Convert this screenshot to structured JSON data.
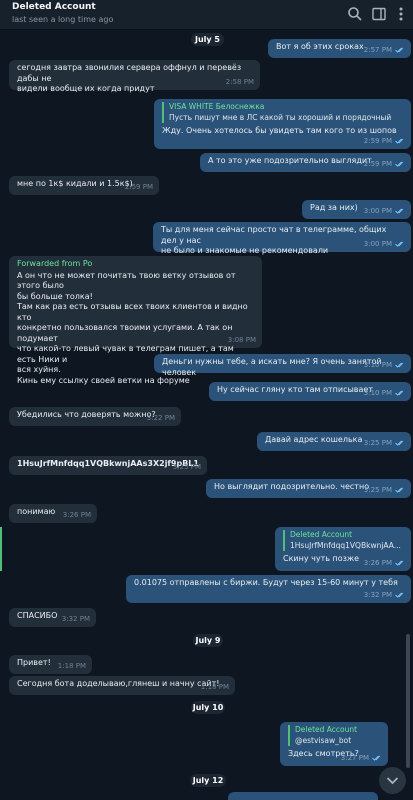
{
  "header": {
    "title": "Deleted Account",
    "status": "last seen a long time ago"
  },
  "dates": [
    "July 5",
    "July 9",
    "July 10",
    "July 12"
  ],
  "messages": [
    {
      "text": "Вот я об этих сроках",
      "time": "2:57 PM"
    },
    {
      "text": "сегодня завтра звонилия сервера оффнул и перевёз дабы не\nвидели вообще их когда придут",
      "time": "2:58 PM"
    },
    {
      "reply_name": "VISA WHITE Белоснежка",
      "reply_text": "Пусть пишут мне в ЛС какой ты хороший и порядочный",
      "text": "Жду. Очень хотелось бы увидеть там кого то из шопов",
      "time": "2:59 PM"
    },
    {
      "text": "А то это уже подозрительно выглядит",
      "time": "2:59 PM"
    },
    {
      "text": "мне по 1к$ кидали и 1.5к$)",
      "time": "2:59 PM"
    },
    {
      "text": "Рад за них)",
      "time": "3:00 PM"
    },
    {
      "text": "Ты для меня сейчас просто чат в телеграмме, общих дел у нас\nне было и знакомые не рекомендовали",
      "time": "3:00 PM"
    },
    {
      "fwd": "Forwarded from Po",
      "text": "А он что не может почитать твою ветку отзывов от этого было\nбы больше толка!\nТам как раз есть отзывы всех твоих клиентов и видно кто\nконкретно пользовался твоими услугами. А так он подумает\nчто какой-то левый чувак в телеграм пишет, а там есть Ники и\nвся хуйня.\nКинь ему ссылку своей ветки на форуме",
      "time": "3:08 PM"
    },
    {
      "text": "Деньги нужны тебе, а искать мне? Я очень занятой человек",
      "time": "3:10 PM"
    },
    {
      "text": "Ну сейчас гляну кто там отписывает",
      "time": "3:10 PM"
    },
    {
      "text": "Убедились что доверять можно?",
      "time": "3:22 PM"
    },
    {
      "text": "Давай адрес кошелька",
      "time": "3:25 PM"
    },
    {
      "text": "1HsuJrfMnfdqq1VQBkwnjAAs3X2jf9pBL1",
      "time": "3:25 PM"
    },
    {
      "text": "Но выглядит подозрительно. честно",
      "time": "3:25 PM"
    },
    {
      "text": "понимаю",
      "time": "3:26 PM"
    },
    {
      "reply_name": "Deleted Account",
      "reply_text": "1HsuJrfMnfdqq1VQBkwnjAA...",
      "text": "Скину чуть позже",
      "time": "3:26 PM"
    },
    {
      "text": "0.01075 отправлены с биржи. Будут через 15-60 минут у тебя",
      "time": "3:32 PM"
    },
    {
      "text": "СПАСИБО",
      "time": "3:32 PM"
    },
    {
      "text": "Привет!",
      "time": "1:18 PM"
    },
    {
      "text": "Сегодня бота доделываю,глянеш и начну сайт!",
      "time": "1:18 PM"
    },
    {
      "reply_name": "Deleted Account",
      "reply_text": "@estvisaw_bot",
      "text": "Здесь смотреть?",
      "time": "3:27 PM"
    }
  ],
  "colors": {
    "background": "#0e1621",
    "incoming": "#222e3a",
    "outgoing": "#2b5278",
    "accent_green": "#6ee39a"
  },
  "icons": [
    "search-icon",
    "sidebar-toggle-icon",
    "more-icon",
    "chevron-down-icon",
    "double-check-icon"
  ]
}
